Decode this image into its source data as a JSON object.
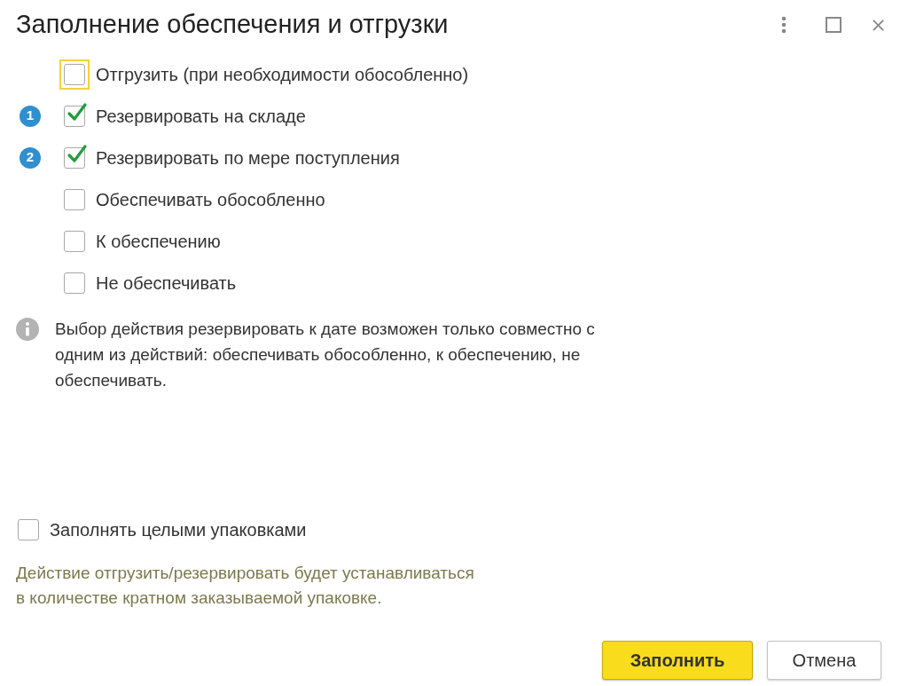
{
  "window": {
    "title": "Заполнение обеспечения и отгрузки"
  },
  "options": [
    {
      "label": "Отгрузить (при необходимости обособленно)",
      "checked": false,
      "focused": true
    },
    {
      "label": "Резервировать на складе",
      "checked": true,
      "focused": false,
      "badge": "1"
    },
    {
      "label": "Резервировать по мере поступления",
      "checked": true,
      "focused": false,
      "badge": "2"
    },
    {
      "label": "Обеспечивать обособленно",
      "checked": false,
      "focused": false
    },
    {
      "label": "К обеспечению",
      "checked": false,
      "focused": false
    },
    {
      "label": "Не обеспечивать",
      "checked": false,
      "focused": false
    }
  ],
  "info": "Выбор действия резервировать к дате возможен только совместно с одним из действий: обеспечивать обособленно, к обеспечению, не обеспечивать.",
  "packaging": {
    "label": "Заполнять целыми упаковками",
    "checked": false
  },
  "note": [
    "Действие отгрузить/резервировать будет устанавливаться",
    "в количестве кратном заказываемой упаковке."
  ],
  "buttons": [
    {
      "label": "Заполнить",
      "kind": "primary"
    },
    {
      "label": "Отмена",
      "kind": "secondary"
    }
  ]
}
